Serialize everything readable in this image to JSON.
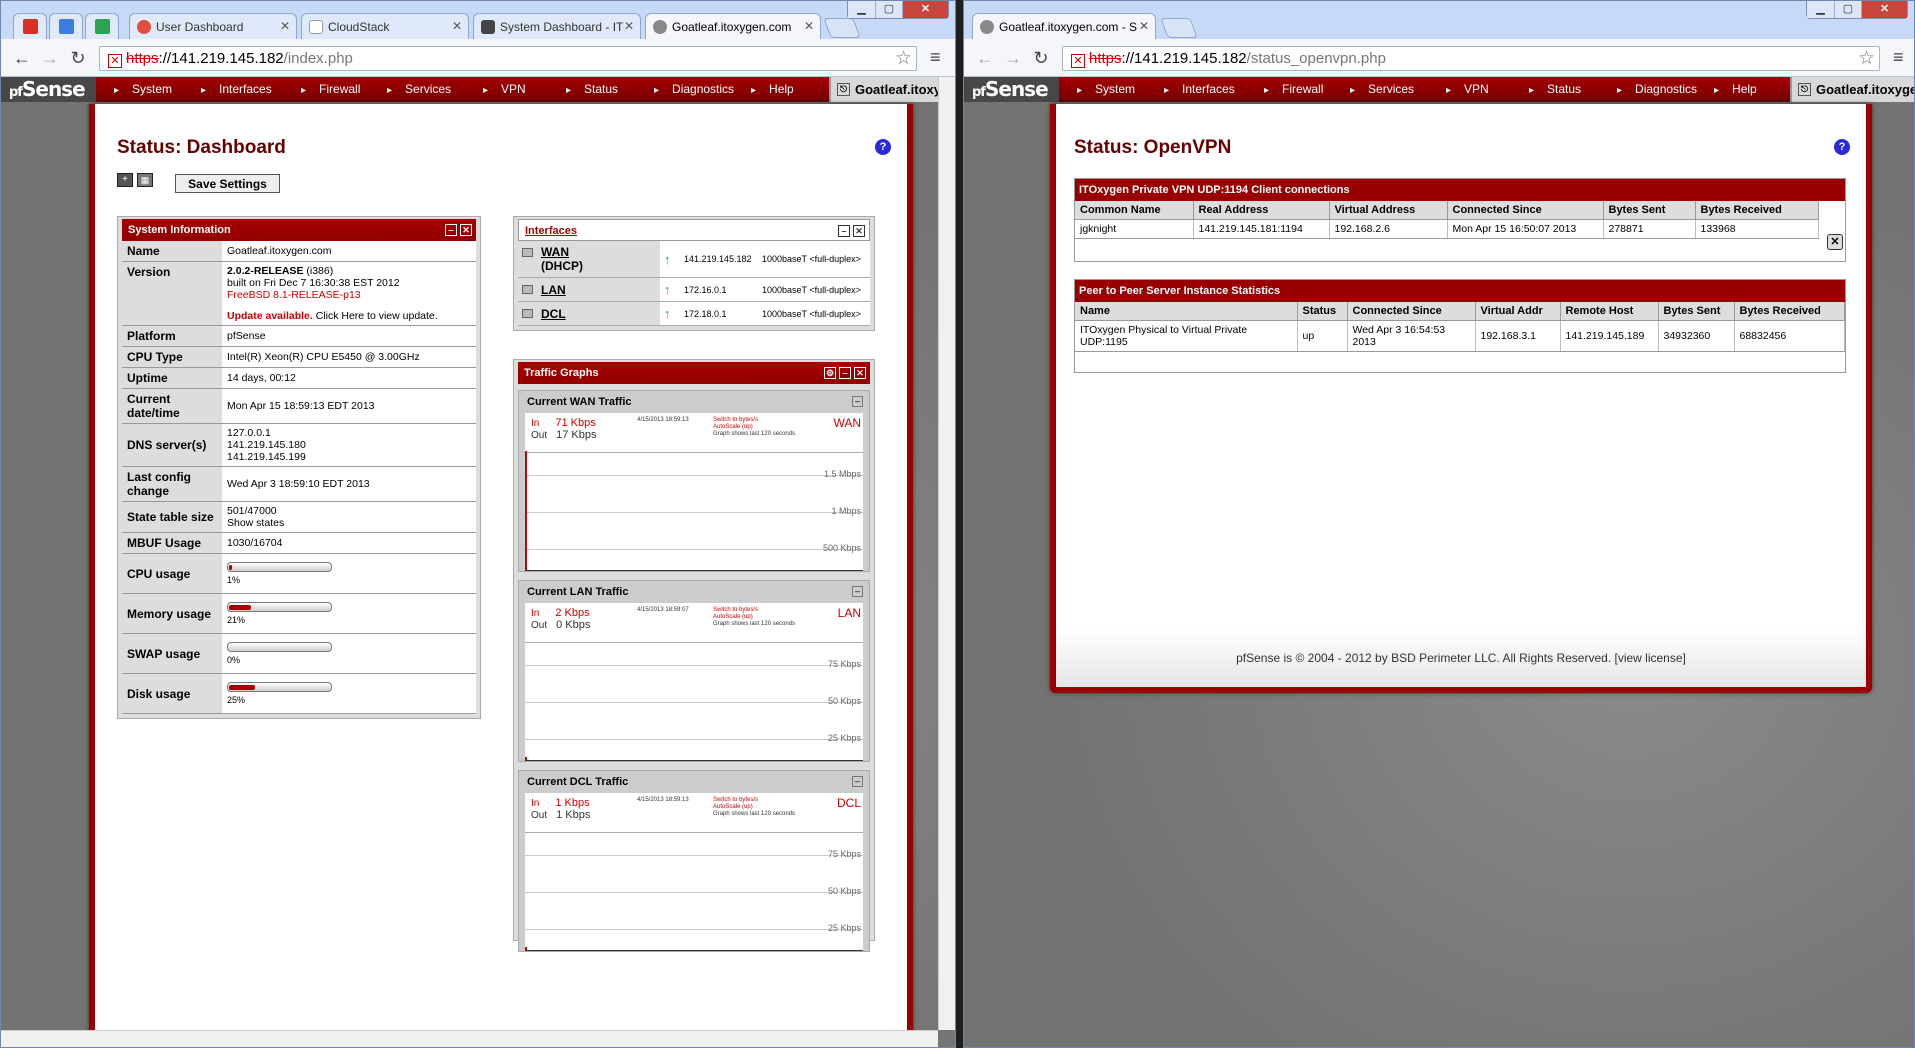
{
  "left_window": {
    "pinned_tabs": [
      {
        "name": "gmail-icon",
        "color": "#d93025"
      },
      {
        "name": "calendar-icon",
        "color": "#3b7de0"
      },
      {
        "name": "drive-icon",
        "color": "#2aa353"
      }
    ],
    "tabs": [
      {
        "label": "User Dashboard",
        "icon": "#e14e3e"
      },
      {
        "label": "CloudStack",
        "icon": "#ffffff"
      },
      {
        "label": "System Dashboard - IT",
        "icon": "#444444"
      },
      {
        "label": "Goatleaf.itoxygen.com",
        "icon": "#888888"
      }
    ],
    "url_scheme": "https",
    "url_host": "://141.219.145.182",
    "url_path": "/index.php"
  },
  "right_window": {
    "tabs": [
      {
        "label": "Goatleaf.itoxygen.com - S",
        "icon": "#888888"
      }
    ],
    "url_scheme": "https",
    "url_host": "://141.219.145.182",
    "url_path": "/status_openvpn.php"
  },
  "nav": {
    "logo": "Sense",
    "logo_mark": "pf",
    "items": [
      "System",
      "Interfaces",
      "Firewall",
      "Services",
      "VPN",
      "Status",
      "Diagnostics",
      "Help"
    ],
    "host": "Goatleaf.itoxygen.com"
  },
  "dashboard": {
    "title": "Status: Dashboard",
    "save_settings": "Save Settings",
    "sysinfo": {
      "title": "System Information",
      "rows": [
        {
          "label": "Name",
          "value": "Goatleaf.itoxygen.com"
        },
        {
          "label": "Platform",
          "value": "pfSense"
        },
        {
          "label": "CPU Type",
          "value": "Intel(R) Xeon(R) CPU E5450 @ 3.00GHz"
        },
        {
          "label": "Uptime",
          "value": "14 days, 00:12"
        },
        {
          "label": "Current date/time",
          "value": "Mon Apr 15 18:59:13 EDT 2013"
        }
      ],
      "version_label": "Version",
      "version_main": "2.0.2-RELEASE",
      "version_arch": " (i386)",
      "version_built": "built on Fri Dec 7 16:30:38 EST 2012",
      "version_os": "FreeBSD 8.1-RELEASE-p13",
      "update_bold": "Update available.",
      "update_link": " Click Here to view update.",
      "dns_label": "DNS server(s)",
      "dns": [
        "127.0.0.1",
        "141.219.145.180",
        "141.219.145.199"
      ],
      "lastcfg_label": "Last config change",
      "lastcfg": "Wed Apr 3 18:59:10 EDT 2013",
      "state_label": "State table size",
      "state_value": "501/47000",
      "state_link": "Show states",
      "mbuf_label": "MBUF Usage",
      "mbuf": "1030/16704",
      "usage": [
        {
          "label": "CPU usage",
          "pct": "1%",
          "fraction": 0.01
        },
        {
          "label": "Memory usage",
          "pct": "21%",
          "fraction": 0.21
        },
        {
          "label": "SWAP usage",
          "pct": "0%",
          "fraction": 0.0
        },
        {
          "label": "Disk usage",
          "pct": "25%",
          "fraction": 0.25
        }
      ]
    },
    "interfaces": {
      "title": "Interfaces",
      "rows": [
        {
          "name": "WAN",
          "sub": "(DHCP)",
          "ip": "141.219.145.182",
          "media": "1000baseT <full-duplex>"
        },
        {
          "name": "LAN",
          "sub": "",
          "ip": "172.16.0.1",
          "media": "1000baseT <full-duplex>"
        },
        {
          "name": "DCL",
          "sub": "",
          "ip": "172.18.0.1",
          "media": "1000baseT <full-duplex>"
        }
      ]
    },
    "traffic": {
      "title": "Traffic Graphs",
      "graphs": [
        {
          "title": "Current WAN Traffic",
          "in": "71 Kbps",
          "out": "17 Kbps",
          "iface": "WAN",
          "date": "4/15/2013 18:59:13",
          "labels": [
            "1.5 Mbps",
            "1 Mbps",
            "500 Kbps"
          ]
        },
        {
          "title": "Current LAN Traffic",
          "in": "2 Kbps",
          "out": "0 Kbps",
          "iface": "LAN",
          "date": "4/15/2013 18:59:07",
          "labels": [
            "75 Kbps",
            "50 Kbps",
            "25 Kbps"
          ]
        },
        {
          "title": "Current DCL Traffic",
          "in": "1 Kbps",
          "out": "1 Kbps",
          "iface": "DCL",
          "date": "4/15/2013 18:59:13",
          "labels": [
            "75 Kbps",
            "50 Kbps",
            "25 Kbps"
          ]
        }
      ],
      "in_label": "In",
      "out_label": "Out",
      "switch_scale": "Switch to bytes/s",
      "autoscale": "AutoScale (up)",
      "graph_note": "Graph shows last 120 seconds"
    }
  },
  "openvpn": {
    "title": "Status: OpenVPN",
    "client_section": "ITOxygen Private VPN UDP:1194 Client connections",
    "client_headers": [
      "Common Name",
      "Real Address",
      "Virtual Address",
      "Connected Since",
      "Bytes Sent",
      "Bytes Received"
    ],
    "client_rows": [
      [
        "jgknight",
        "141.219.145.181:1194",
        "192.168.2.6",
        "Mon Apr 15 16:50:07 2013",
        "278871",
        "133968"
      ]
    ],
    "p2p_section": "Peer to Peer Server Instance Statistics",
    "p2p_headers": [
      "Name",
      "Status",
      "Connected Since",
      "Virtual Addr",
      "Remote Host",
      "Bytes Sent",
      "Bytes Received"
    ],
    "p2p_rows": [
      [
        "ITOxygen Physical to Virtual Private UDP:1195",
        "up",
        "Wed Apr 3 16:54:53 2013",
        "192.168.3.1",
        "141.219.145.189",
        "34932360",
        "68832456"
      ]
    ],
    "footer_pre": "pfSense is © 2004 - 2012 by BSD Perimeter LLC. All Rights Reserved. [",
    "footer_link": "view license",
    "footer_post": "]"
  }
}
